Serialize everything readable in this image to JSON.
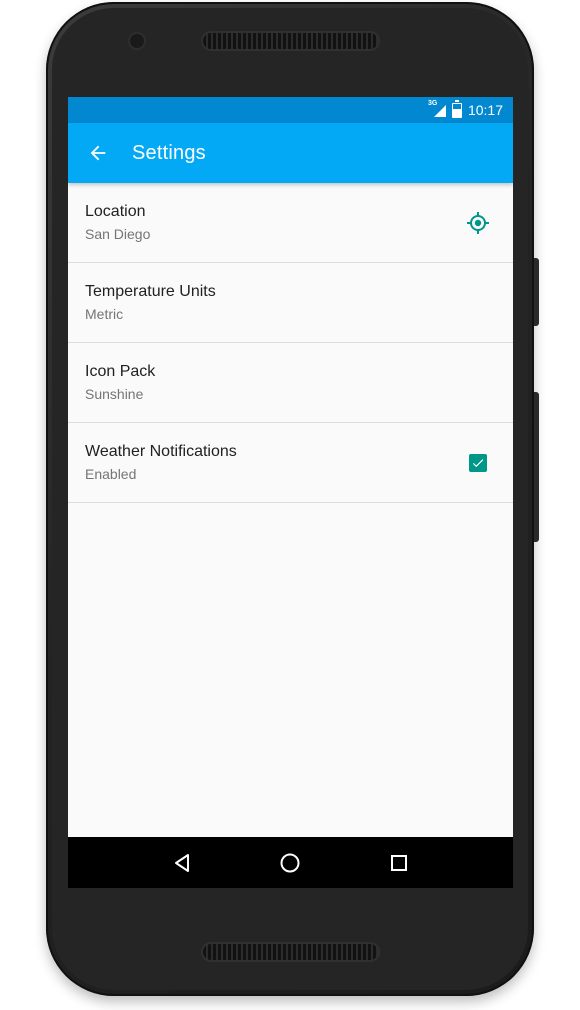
{
  "status_bar": {
    "network": "3G",
    "time": "10:17"
  },
  "app_bar": {
    "title": "Settings",
    "back_icon": "arrow-back-icon",
    "color": "#03a9f4",
    "status_color": "#0288d1"
  },
  "preferences": [
    {
      "title": "Location",
      "summary": "San Diego",
      "widget": "my-location-icon"
    },
    {
      "title": "Temperature Units",
      "summary": "Metric",
      "widget": "none"
    },
    {
      "title": "Icon Pack",
      "summary": "Sunshine",
      "widget": "none"
    },
    {
      "title": "Weather Notifications",
      "summary": "Enabled",
      "widget": "checkbox",
      "checked": true
    }
  ],
  "accent_color": "#009688",
  "nav_bar": {
    "buttons": [
      "back-triangle-icon",
      "home-circle-icon",
      "recents-square-icon"
    ]
  }
}
